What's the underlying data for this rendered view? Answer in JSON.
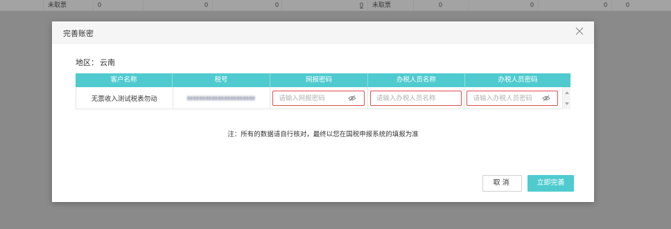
{
  "background_row": {
    "cells": [
      "未取票",
      "0",
      "0",
      "0",
      "0",
      "未取票",
      "0",
      "0",
      "0",
      "0"
    ]
  },
  "dialog": {
    "title": "完善账密",
    "close_icon": "close-icon",
    "region_label": "地区：",
    "region_value": "云南",
    "table": {
      "headers": [
        "客户名称",
        "税号",
        "网报密码",
        "办税人员名称",
        "办税人员密码"
      ],
      "row": {
        "customer_name": "无票收入测试税表勿动",
        "tax_id_masked": true,
        "web_password_placeholder": "请输入网报密码",
        "tax_person_name_placeholder": "请输入办税人员名称",
        "tax_person_password_placeholder": "请输入办税人员密码"
      }
    },
    "note": "注：所有的数据请自行核对，最终以您在国税申报系统的填报为准",
    "buttons": {
      "cancel": "取消",
      "confirm": "立即完善"
    }
  },
  "colors": {
    "accent": "#4fcbcf",
    "input_error_border": "#e04a4a",
    "overlay": "#8a8a8a"
  }
}
